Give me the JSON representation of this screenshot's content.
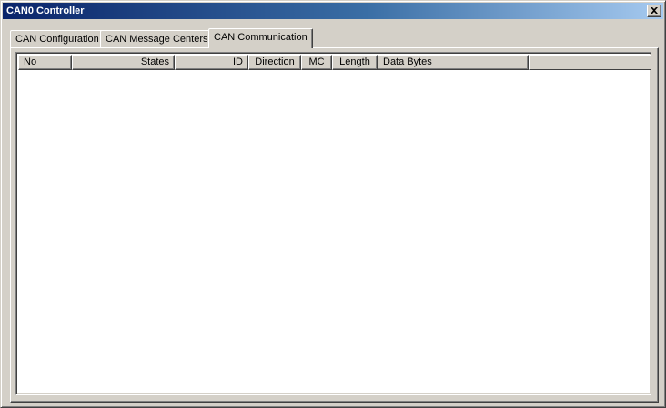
{
  "window": {
    "title": "CAN0 Controller",
    "close_icon": "close-icon"
  },
  "tabs": [
    {
      "label": "CAN Configuration",
      "active": false
    },
    {
      "label": "CAN Message Centers",
      "active": false
    },
    {
      "label": "CAN Communication",
      "active": true
    }
  ],
  "table": {
    "columns": [
      "No",
      "States",
      "ID",
      "Direction",
      "MC",
      "Length",
      "Data Bytes"
    ],
    "rows": []
  },
  "colors": {
    "titlebar_start": "#0a246a",
    "titlebar_end": "#a6caf0",
    "face": "#d4d0c8"
  }
}
